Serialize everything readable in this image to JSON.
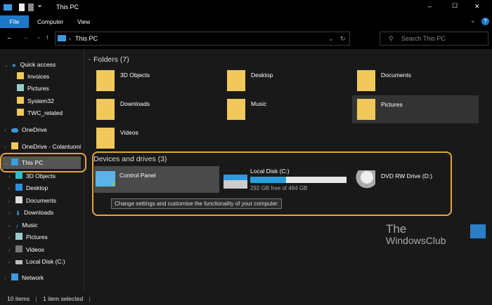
{
  "window": {
    "title": "This PC",
    "minimize": "–",
    "maximize": "☐",
    "close": "✕"
  },
  "ribbon": {
    "tabs": [
      "File",
      "Computer",
      "View"
    ],
    "help": "?",
    "expand": "⌄"
  },
  "address": {
    "path": "This PC",
    "search_placeholder": "Search This PC"
  },
  "sidebar": {
    "items": [
      {
        "label": "Quick access"
      },
      {
        "label": "Invoices"
      },
      {
        "label": "Pictures"
      },
      {
        "label": "System32"
      },
      {
        "label": "TWC_related"
      },
      {
        "label": "OneDrive"
      },
      {
        "label": "OneDrive - Colantuoni"
      },
      {
        "label": "This PC"
      },
      {
        "label": "3D Objects"
      },
      {
        "label": "Desktop"
      },
      {
        "label": "Documents"
      },
      {
        "label": "Downloads"
      },
      {
        "label": "Music"
      },
      {
        "label": "Pictures"
      },
      {
        "label": "Videos"
      },
      {
        "label": "Local Disk (C:)"
      },
      {
        "label": "Network"
      }
    ]
  },
  "folders": {
    "heading": "Folders (7)",
    "items": [
      "3D Objects",
      "Desktop",
      "Documents",
      "Downloads",
      "Music",
      "Pictures",
      "Videos"
    ]
  },
  "drives": {
    "heading": "Devices and drives (3)",
    "items": [
      {
        "label": "Control Panel"
      },
      {
        "label": "Local Disk (C:)",
        "free": "292 GB free of 464 GB",
        "used_fraction": 0.37
      },
      {
        "label": "DVD RW Drive (D:)"
      }
    ],
    "tooltip": "Change settings and customise the functionality of your computer."
  },
  "status": {
    "items": "10 items",
    "selected": "1 item selected"
  },
  "watermark": {
    "line1": "The",
    "line2": "WindowsClub"
  },
  "colors": {
    "accent": "#1e78c8",
    "highlight": "#e8a33a",
    "bar": "#26a0da"
  }
}
